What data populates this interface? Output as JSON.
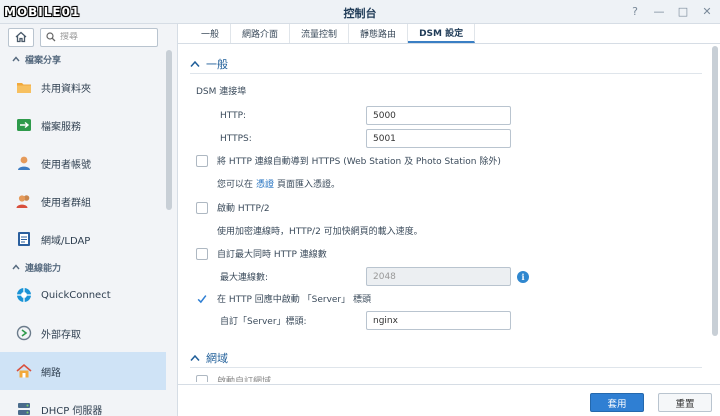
{
  "window": {
    "logo_text": "MOBILE01",
    "title": "控制台"
  },
  "sidebar": {
    "search_placeholder": "搜尋",
    "sections": [
      {
        "label": "檔案分享"
      },
      {
        "label": "連線能力"
      }
    ],
    "items": [
      {
        "label": "共用資料夾",
        "icon": "folder-icon"
      },
      {
        "label": "檔案服務",
        "icon": "file-services-icon"
      },
      {
        "label": "使用者帳號",
        "icon": "user-icon"
      },
      {
        "label": "使用者群組",
        "icon": "user-group-icon"
      },
      {
        "label": "網域/LDAP",
        "icon": "domain-ldap-icon"
      },
      {
        "label": "QuickConnect",
        "icon": "quickconnect-icon"
      },
      {
        "label": "外部存取",
        "icon": "external-access-icon"
      },
      {
        "label": "網路",
        "icon": "network-icon",
        "active": true
      },
      {
        "label": "DHCP 伺服器",
        "icon": "dhcp-server-icon"
      }
    ]
  },
  "tabs": [
    {
      "label": "一般"
    },
    {
      "label": "網路介面"
    },
    {
      "label": "流量控制"
    },
    {
      "label": "靜態路由"
    },
    {
      "label": "DSM 設定",
      "active": true
    }
  ],
  "general": {
    "heading": "一般",
    "port_label": "DSM 連接埠",
    "http_label": "HTTP:",
    "http_value": "5000",
    "https_label": "HTTPS:",
    "https_value": "5001",
    "redirect_label": "將 HTTP 連線自動導到 HTTPS (Web Station 及 Photo Station 除外)",
    "redirect_checked": false,
    "cert_text_before": "您可以在",
    "cert_link": "憑證",
    "cert_text_after": "頁面匯入憑證。",
    "http2_label": "啟動 HTTP/2",
    "http2_checked": false,
    "http2_desc": "使用加密連線時，HTTP/2 可加快網頁的載入速度。",
    "maxconn_label": "自訂最大同時 HTTP 連線數",
    "maxconn_checked": false,
    "maxconn_field_label": "最大連線數:",
    "maxconn_value": "2048",
    "server_header_label": "在 HTTP 回應中啟動 「Server」 標頭",
    "server_header_checked": true,
    "custom_server_label": "自訂「Server」標頭:",
    "custom_server_value": "nginx"
  },
  "domain": {
    "heading": "網域",
    "partial_label": "啟動自訂網域"
  },
  "footer": {
    "apply_label": "套用",
    "reset_label": "重置"
  },
  "colors": {
    "accent": "#2f7fd3",
    "active_nav": "#cfe3f6",
    "heading": "#1f5e99"
  }
}
